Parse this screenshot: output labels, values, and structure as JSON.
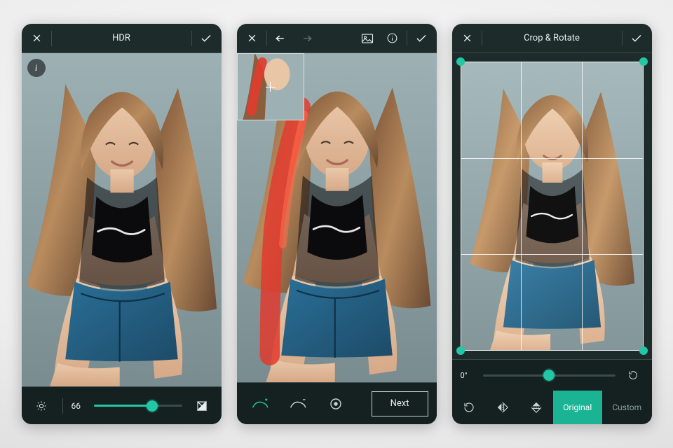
{
  "panels": {
    "hdr": {
      "title": "HDR",
      "slider_value": "66",
      "slider_percent": 66
    },
    "retouch": {
      "next_label": "Next"
    },
    "crop": {
      "title": "Crop & Rotate",
      "angle_label": "0°",
      "angle_center_percent": 50,
      "tabs": {
        "original": "Original",
        "custom": "Custom"
      }
    }
  },
  "accent": "#1ab394"
}
